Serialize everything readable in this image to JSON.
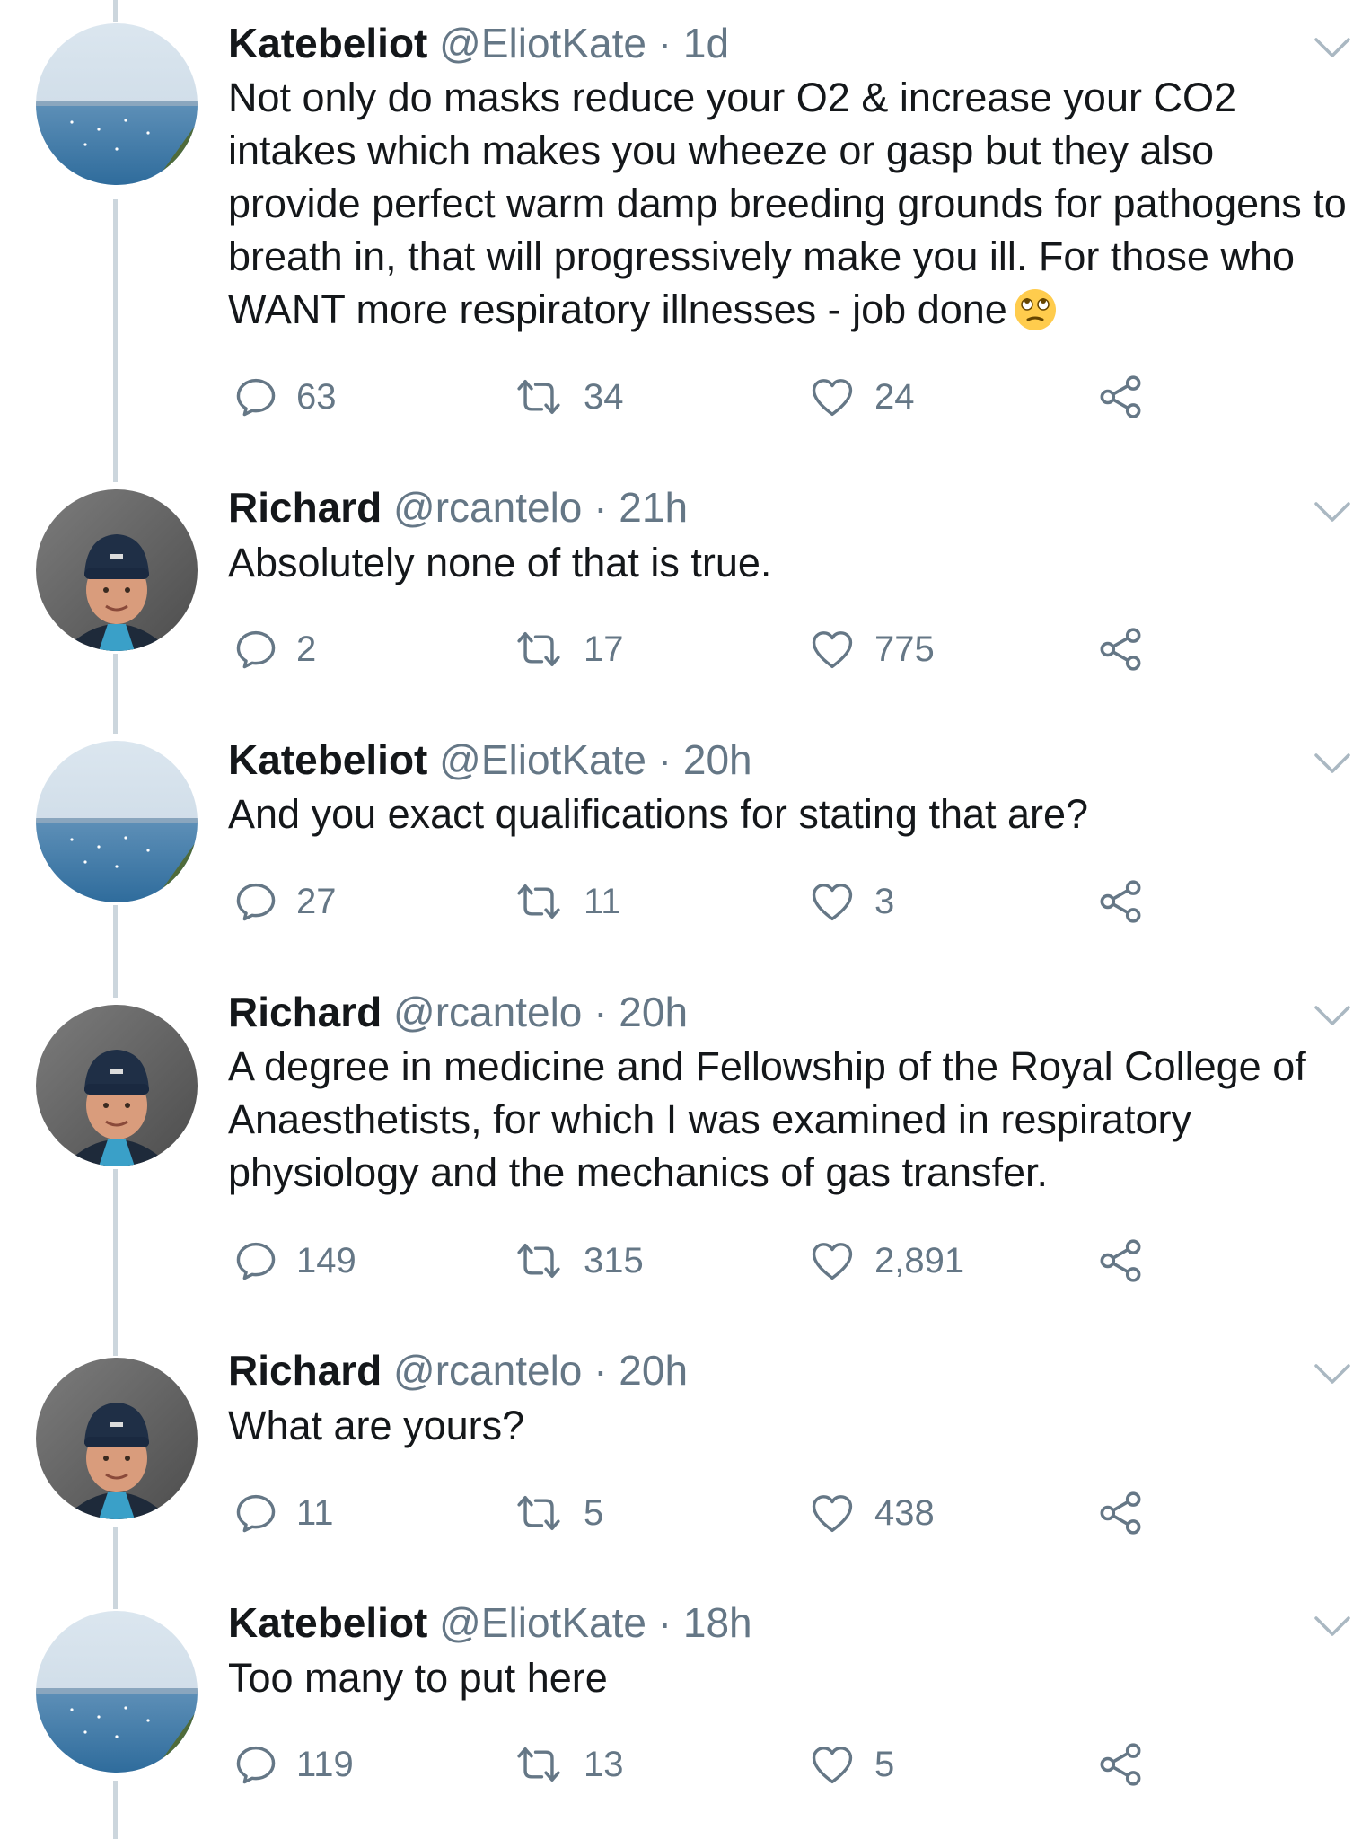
{
  "tweets": [
    {
      "name": "Katebeliot",
      "handle": "@EliotKate",
      "sep": "·",
      "time": "1d",
      "text": "Not only do masks reduce your O2 & increase your CO2 intakes which makes you wheeze or gasp but they also provide perfect warm damp breeding grounds for pathogens to breath in, that will progressively make you ill. For those who WANT more respiratory illnesses - job done",
      "emoji": "face-with-rolling-eyes",
      "avatar": "sea-landscape",
      "replies": "63",
      "retweets": "34",
      "likes": "24"
    },
    {
      "name": "Richard",
      "handle": "@rcantelo",
      "sep": "·",
      "time": "21h",
      "text": "Absolutely none of that is true.",
      "avatar": "man-in-beanie",
      "replies": "2",
      "retweets": "17",
      "likes": "775"
    },
    {
      "name": "Katebeliot",
      "handle": "@EliotKate",
      "sep": "·",
      "time": "20h",
      "text": "And you exact qualifications for stating that are?",
      "avatar": "sea-landscape",
      "replies": "27",
      "retweets": "11",
      "likes": "3"
    },
    {
      "name": "Richard",
      "handle": "@rcantelo",
      "sep": "·",
      "time": "20h",
      "text": "A degree in medicine and Fellowship of the Royal College of Anaesthetists, for which I was examined in respiratory physiology and the mechanics of gas transfer.",
      "avatar": "man-in-beanie",
      "replies": "149",
      "retweets": "315",
      "likes": "2,891"
    },
    {
      "name": "Richard",
      "handle": "@rcantelo",
      "sep": "·",
      "time": "20h",
      "text": "What are yours?",
      "avatar": "man-in-beanie",
      "replies": "11",
      "retweets": "5",
      "likes": "438"
    },
    {
      "name": "Katebeliot",
      "handle": "@EliotKate",
      "sep": "·",
      "time": "18h",
      "text": "Too many to put here",
      "avatar": "sea-landscape",
      "replies": "119",
      "retweets": "13",
      "likes": "5"
    }
  ],
  "icons": {
    "reply": "reply-icon",
    "retweet": "retweet-icon",
    "like": "heart-icon",
    "share": "share-icon",
    "more": "chevron-down-icon"
  },
  "colors": {
    "text": "#14171a",
    "secondary": "#657786",
    "thread_line": "#ccd6dd"
  }
}
